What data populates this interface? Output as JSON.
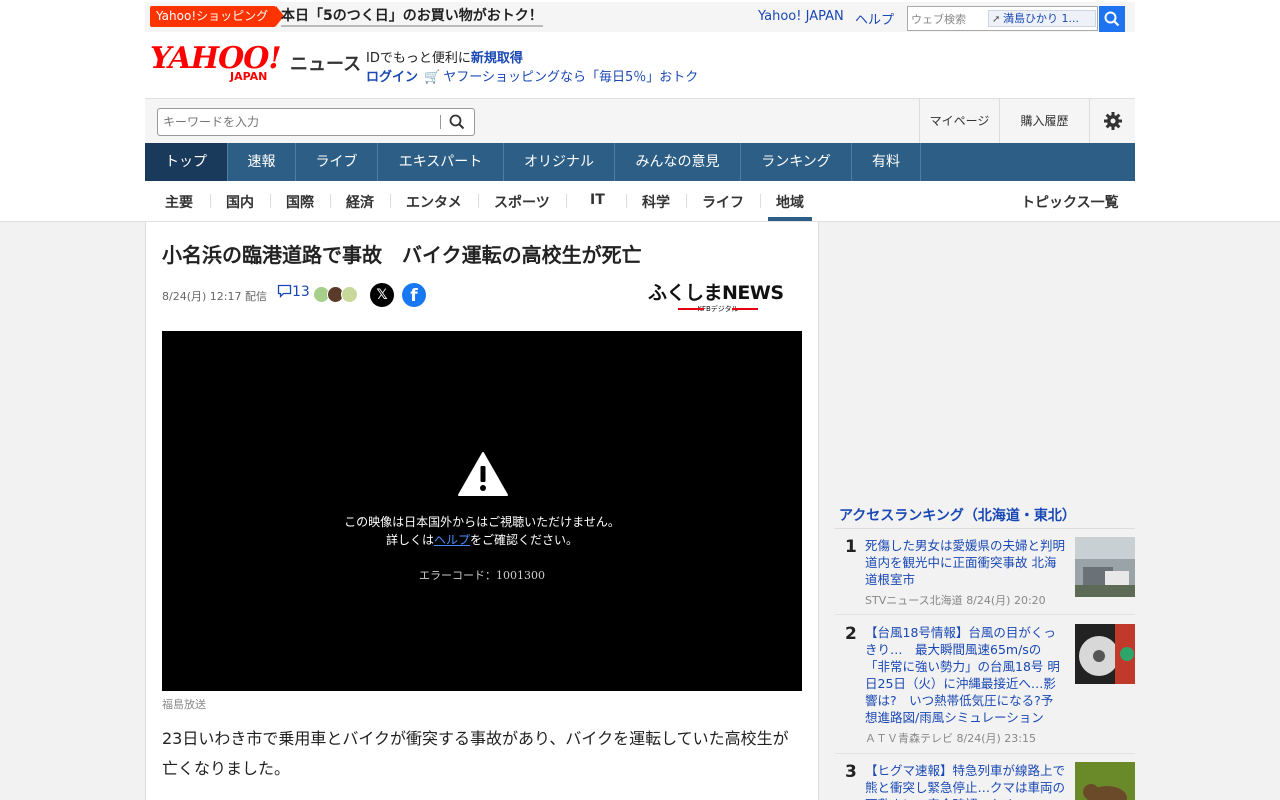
{
  "promo": {
    "badge": "Yahoo!ショッピング",
    "text": "本日「5のつく日」のお買い物がおトク！"
  },
  "util": {
    "home_link": "Yahoo! JAPAN",
    "help_link": "ヘルプ",
    "search_placeholder": "ウェブ検索",
    "search_suggestion": "満島ひかり 1..."
  },
  "header": {
    "logo_main": "YAHOO!",
    "logo_sub": "JAPAN",
    "brand": "ニュース",
    "login_prompt": "IDでもっと便利に",
    "signup_link": "新規取得",
    "login_link": "ログイン",
    "shopping_link": "ヤフーショッピングなら「毎日5％」おトク"
  },
  "search_row": {
    "keyword_placeholder": "キーワードを入力",
    "mypage": "マイページ",
    "history": "購入履歴"
  },
  "main_nav": [
    {
      "label": "トップ",
      "active": true
    },
    {
      "label": "速報"
    },
    {
      "label": "ライブ"
    },
    {
      "label": "エキスパート"
    },
    {
      "label": "オリジナル"
    },
    {
      "label": "みんなの意見"
    },
    {
      "label": "ランキング"
    },
    {
      "label": "有料"
    }
  ],
  "sub_nav": [
    {
      "label": "主要"
    },
    {
      "label": "国内"
    },
    {
      "label": "国際"
    },
    {
      "label": "経済"
    },
    {
      "label": "エンタメ"
    },
    {
      "label": "スポーツ"
    },
    {
      "label": "IT"
    },
    {
      "label": "科学"
    },
    {
      "label": "ライフ"
    },
    {
      "label": "地域",
      "active": true
    }
  ],
  "topics_link": "トピックス一覧",
  "article": {
    "title": "小名浜の臨港道路で事故　バイク運転の高校生が死亡",
    "date": "8/24(月) 12:17",
    "delivered": "配信",
    "comment_count": "13",
    "share_x": "𝕏",
    "share_fb": "f",
    "source_logo": "ふくしまNEWS",
    "source_logo_sub": "KFBデジタル",
    "video_msg_1": "この映像は日本国外からはご視聴いただけません。",
    "video_msg_2_pre": "詳しくは",
    "video_msg_2_link": "ヘルプ",
    "video_msg_2_post": "をご確認ください。",
    "video_error": "エラーコード：1001300",
    "caption": "福島放送",
    "body": "23日いわき市で乗用車とバイクが衝突する事故があり、バイクを運転していた高校生が亡くなりました。"
  },
  "ranking": {
    "title": "アクセスランキング（北海道・東北）",
    "items": [
      {
        "rank": "1",
        "text": "死傷した男女は愛媛県の夫婦と判明　道内を観光中に正面衝突事故 北海道根室市",
        "source": "STVニュース北海道",
        "date": "8/24(月) 20:20"
      },
      {
        "rank": "2",
        "text": "【台風18号情報】台風の目がくっきり…　最大瞬間風速65m/sの「非常に強い勢力」の台風18号 明日25日（火）に沖縄最接近へ…影響は?　いつ熱帯低気圧になる?予想進路図/雨風シミュレーション",
        "source": "ＡＴＶ青森テレビ",
        "date": "8/24(月) 23:15"
      },
      {
        "rank": "3",
        "text": "【ヒグマ速報】特急列車が線路上で熊と衝突し緊急停止…クマは車両の下敷きに　安全確認のため",
        "source": "",
        "date": ""
      }
    ]
  }
}
